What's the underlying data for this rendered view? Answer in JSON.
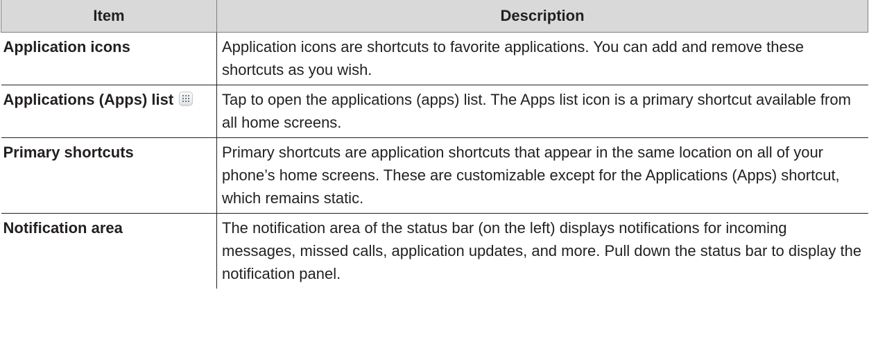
{
  "table": {
    "headers": {
      "item": "Item",
      "description": "Description"
    },
    "rows": [
      {
        "item": "Application icons",
        "description": "Application icons are shortcuts to favorite applications. You can add and remove these shortcuts as you wish."
      },
      {
        "item": "Applications (Apps) list",
        "item_icon": "apps-grid-icon",
        "description": "Tap to open the applications (apps) list. The Apps list icon is a primary shortcut available from all home screens."
      },
      {
        "item": "Primary shortcuts",
        "description": "Primary shortcuts are application shortcuts that appear in the same location on all of your phone’s home screens. These are customizable except for the Applications (Apps) shortcut, which remains static."
      },
      {
        "item": "Notification area",
        "description": "The notification area of the status bar (on the left) displays notifications for incoming messages, missed calls, application updates, and more. Pull down the status bar to display the notification panel."
      }
    ]
  }
}
